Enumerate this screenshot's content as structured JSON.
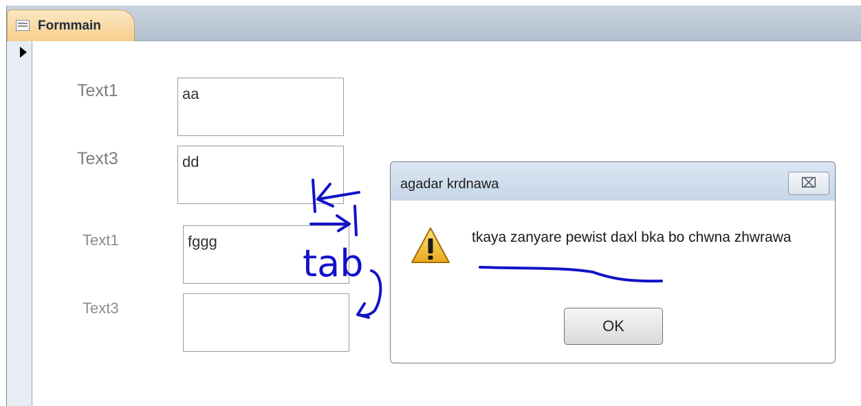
{
  "tab": {
    "title": "Formmain",
    "icon": "form-icon"
  },
  "form": {
    "fields": [
      {
        "label": "Text1",
        "value": "aa"
      },
      {
        "label": "Text3",
        "value": "dd"
      },
      {
        "label": "Text1",
        "value": "fggg"
      },
      {
        "label": "Text3",
        "value": ""
      }
    ]
  },
  "dialog": {
    "title": "agadar krdnawa",
    "message": "tkaya zanyare pewist daxl bka bo chwna zhwrawa",
    "ok_label": "OK",
    "close_glyph": "⌧",
    "icon": "warning-icon"
  },
  "annotation": {
    "text": "tab",
    "color": "#1212c8"
  }
}
